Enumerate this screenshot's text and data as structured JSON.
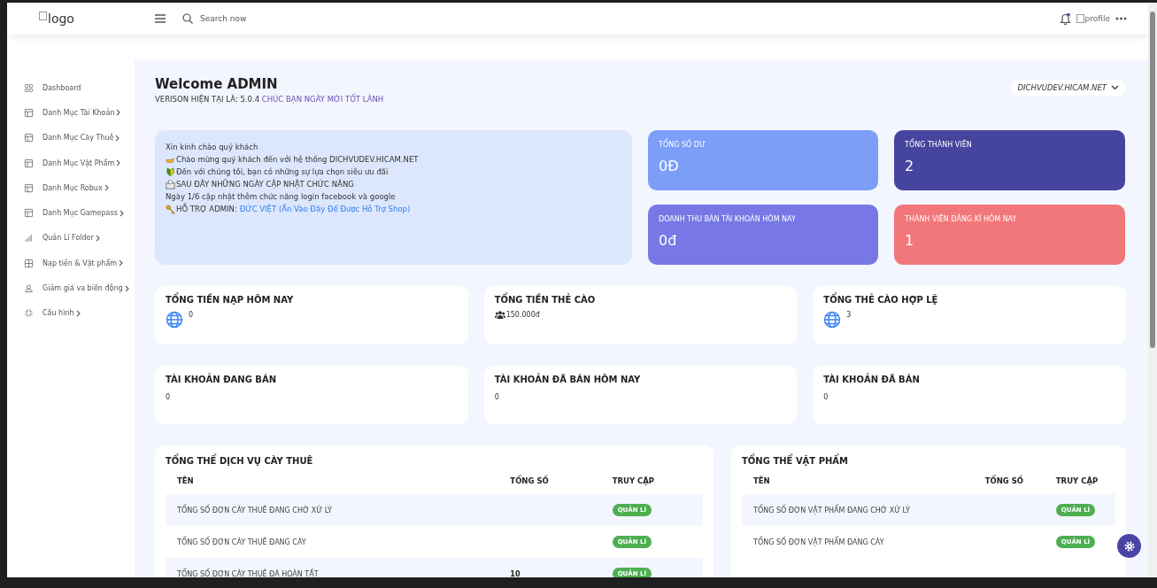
{
  "header": {
    "logo_alt": "logo",
    "search": {
      "placeholder": "Search now"
    },
    "profile_alt": "profile"
  },
  "sidebar": {
    "items": [
      {
        "label": "Dashboard",
        "kind": "grid",
        "chevron": false
      },
      {
        "label": "Danh Mục Tài Khoản",
        "kind": "layout",
        "chevron": true
      },
      {
        "label": "Danh Mục Cày Thuê",
        "kind": "layout",
        "chevron": true
      },
      {
        "label": "Danh Mục Vật Phẩm",
        "kind": "layout",
        "chevron": true
      },
      {
        "label": "Danh Mục Robux",
        "kind": "layout",
        "chevron": true
      },
      {
        "label": "Danh Mục Gamepass",
        "kind": "layout",
        "chevron": true
      },
      {
        "label": "Quản Lí Folder",
        "kind": "chart",
        "chevron": true
      },
      {
        "label": "Nạp tiền & Vật phẩm",
        "kind": "table",
        "chevron": true
      },
      {
        "label": "Giảm giá va biến động",
        "kind": "user",
        "chevron": true
      },
      {
        "label": "Cấu hình",
        "kind": "shrink",
        "chevron": true
      }
    ]
  },
  "welcome": {
    "title": "Welcome ADMIN",
    "version": "VERISON HIỆN TẠI LÀ: 5.0.4",
    "greeting": "CHÚC BẠN NGÀY MỚI TỐT LÀNH",
    "domain_select": "DICHVUDEV.HICAM.NET"
  },
  "notice": {
    "lines": [
      {
        "kind": "plain",
        "text": "Xin kính chào quý khách"
      },
      {
        "kind": "hand",
        "text": "Chào mừng quý khách đến với hệ thống DICHVUDEV.HICAM.NET"
      },
      {
        "kind": "shield",
        "text": "Đến với chúng tôi, bạn có những sự lựa chọn siêu ưu đãi"
      },
      {
        "kind": "inbox",
        "text": "SAU ĐÂY NHỮNG NGÀY CẬP NHẬT CHỨC NĂNG"
      },
      {
        "kind": "plain",
        "text": "Ngày 1/6 cập nhật thêm chức năng login facebook và google"
      },
      {
        "kind": "key",
        "text": "HỖ TRỢ ADMIN:",
        "link": "ĐỨC VIỆT (Ấn Vào Đây Để Được Hỗ Trợ Shop)"
      }
    ]
  },
  "stat_cards": [
    {
      "label": "TỔNG SỐ DƯ",
      "value": "0Đ",
      "color": "#7c9ef9"
    },
    {
      "label": "TỔNG THÀNH VIÊN",
      "value": "2",
      "color": "#46459e"
    },
    {
      "label": "DOANH THU BÁN TÀI KHOẢN HÔM NAY",
      "value": "0đ",
      "color": "#7778e5"
    },
    {
      "label": "THÀNH VIÊN ĐĂNG KÍ HÔM NAY",
      "value": "1",
      "color": "#f2777b"
    }
  ],
  "summary_cards": [
    {
      "title": "TỔNG TIỀN NẠP HÔM NAY",
      "kind": "globe",
      "value": "0"
    },
    {
      "title": "TỔNG TIỀN THẺ CÀO",
      "kind": "users",
      "value": "150.000đ"
    },
    {
      "title": "TỔNG THẺ CÀO HỢP LỆ",
      "kind": "globe",
      "value": "3"
    },
    {
      "title": "TÀI KHOẢN ĐANG BÁN",
      "kind": "plain",
      "value": "0"
    },
    {
      "title": "TÀI KHOẢN ĐÃ BÁN HÔM NAY",
      "kind": "plain",
      "value": "0"
    },
    {
      "title": "TÀI KHOẢN ĐÃ BÁN",
      "kind": "plain",
      "value": "0"
    }
  ],
  "tables": [
    {
      "title": "TỔNG THỂ DỊCH VỤ CÀY THUÊ",
      "columns": [
        "TÊN",
        "TỔNG SỐ",
        "TRUY CẬP"
      ],
      "rows": [
        {
          "name": "TỔNG SỐ ĐƠN CÀY THUÊ ĐANG CHỜ XỬ LÝ",
          "action": "QUẢN LÍ"
        },
        {
          "name": "TỔNG SỐ ĐƠN CÀY THUÊ ĐANG CÀY",
          "action": "QUẢN LÍ"
        },
        {
          "name": "TỔNG SỐ ĐƠN CÀY THUÊ ĐÃ HOÀN TẤT",
          "total": "10",
          "action": "QUẢN LÍ"
        }
      ]
    },
    {
      "title": "TỔNG THỂ VẬT PHẨM",
      "columns": [
        "TÊN",
        "TỔNG SỐ",
        "TRUY CẬP"
      ],
      "rows": [
        {
          "name": "TỔNG SỐ ĐƠN VẬT PHẨM ĐANG CHỜ XỬ LÝ",
          "action": "QUẢN LÍ"
        },
        {
          "name": "TỔNG SỐ ĐƠN VẬT PHẨM ĐANG CÀY",
          "action": "QUẢN LÍ"
        }
      ]
    }
  ]
}
